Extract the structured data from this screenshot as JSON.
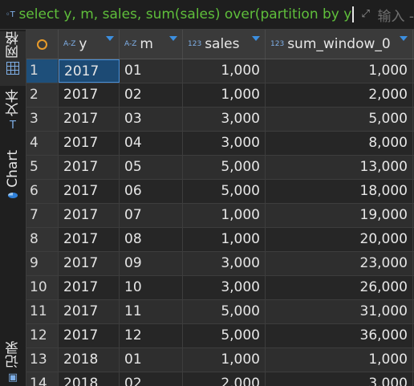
{
  "filter": {
    "query_text": "select y, m, sales, sum(sales) over(partition by y o",
    "input_hint": "输入 -"
  },
  "sidebar": {
    "tabs": [
      {
        "label": "网格",
        "icon": "grid-icon"
      },
      {
        "label": "文本",
        "icon": "text-icon"
      },
      {
        "label": "Chart",
        "icon": "pie-chart-icon"
      },
      {
        "label": "记录",
        "icon": "record-icon"
      }
    ]
  },
  "columns": [
    {
      "label": "y",
      "type": "A-Z"
    },
    {
      "label": "m",
      "type": "A-Z"
    },
    {
      "label": "sales",
      "type": "123"
    },
    {
      "label": "sum_window_0",
      "type": "123"
    }
  ],
  "rows": [
    {
      "n": "1",
      "y": "2017",
      "m": "01",
      "sales": "1,000",
      "sum": "1,000"
    },
    {
      "n": "2",
      "y": "2017",
      "m": "02",
      "sales": "1,000",
      "sum": "2,000"
    },
    {
      "n": "3",
      "y": "2017",
      "m": "03",
      "sales": "3,000",
      "sum": "5,000"
    },
    {
      "n": "4",
      "y": "2017",
      "m": "04",
      "sales": "3,000",
      "sum": "8,000"
    },
    {
      "n": "5",
      "y": "2017",
      "m": "05",
      "sales": "5,000",
      "sum": "13,000"
    },
    {
      "n": "6",
      "y": "2017",
      "m": "06",
      "sales": "5,000",
      "sum": "18,000"
    },
    {
      "n": "7",
      "y": "2017",
      "m": "07",
      "sales": "1,000",
      "sum": "19,000"
    },
    {
      "n": "8",
      "y": "2017",
      "m": "08",
      "sales": "1,000",
      "sum": "20,000"
    },
    {
      "n": "9",
      "y": "2017",
      "m": "09",
      "sales": "3,000",
      "sum": "23,000"
    },
    {
      "n": "10",
      "y": "2017",
      "m": "10",
      "sales": "3,000",
      "sum": "26,000"
    },
    {
      "n": "11",
      "y": "2017",
      "m": "11",
      "sales": "5,000",
      "sum": "31,000"
    },
    {
      "n": "12",
      "y": "2017",
      "m": "12",
      "sales": "5,000",
      "sum": "36,000"
    },
    {
      "n": "13",
      "y": "2018",
      "m": "01",
      "sales": "1,000",
      "sum": "1,000"
    },
    {
      "n": "14",
      "y": "2018",
      "m": "02",
      "sales": "2,000",
      "sum": "3,000"
    }
  ]
}
